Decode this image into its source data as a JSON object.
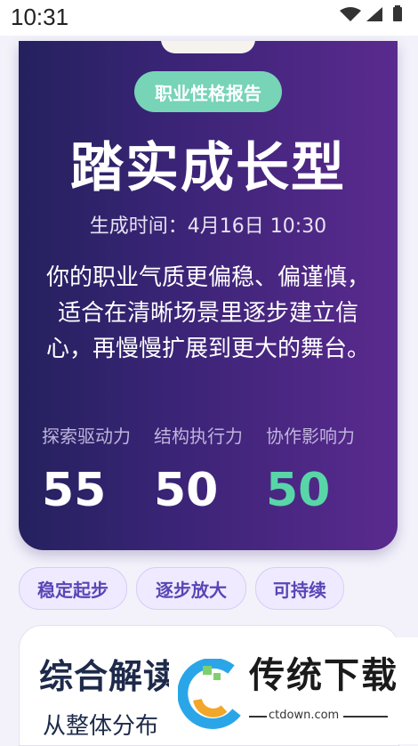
{
  "status_bar": {
    "time": "10:31"
  },
  "report": {
    "badge": "职业性格报告",
    "title": "踏实成长型",
    "generated": "生成时间：4月16日 10:30",
    "description": "你的职业气质更偏稳、偏谨慎，适合在清晰场景里逐步建立信心，再慢慢扩展到更大的舞台。",
    "metrics": [
      {
        "label": "探索驱动力",
        "value": "55"
      },
      {
        "label": "结构执行力",
        "value": "50"
      },
      {
        "label": "协作影响力",
        "value": "50"
      }
    ]
  },
  "tags": [
    "稳定起步",
    "逐步放大",
    "可持续"
  ],
  "section": {
    "title": "综合解读",
    "subtitle": "从整体分布"
  },
  "watermark": {
    "text": "传统下载",
    "url": "ctdown.com"
  },
  "colors": {
    "accent": "#58d6a8",
    "badge": "#77d4b6",
    "tag_text": "#5b45b6"
  }
}
